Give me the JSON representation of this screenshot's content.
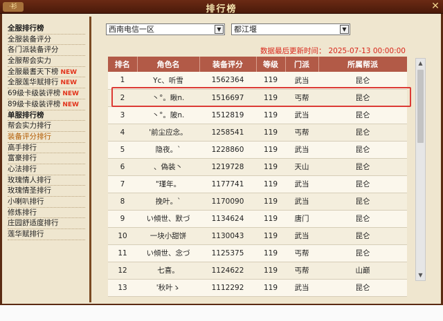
{
  "window": {
    "title": "排行榜",
    "logo_text": "·衫",
    "close_glyph": "✕"
  },
  "sidebar": {
    "items": [
      {
        "label": "全服排行榜",
        "type": "header",
        "new": ""
      },
      {
        "label": "全服装备评分",
        "type": "item",
        "new": ""
      },
      {
        "label": "各门派装备评分",
        "type": "item",
        "new": ""
      },
      {
        "label": "全服帮会实力",
        "type": "item",
        "new": ""
      },
      {
        "label": "全服最耆天下榜",
        "type": "item",
        "new": "NEW"
      },
      {
        "label": "全服莲华赋排行",
        "type": "item",
        "new": "NEW"
      },
      {
        "label": "69级卡级装评榜",
        "type": "item",
        "new": "NEW"
      },
      {
        "label": "89级卡级装评榜",
        "type": "item",
        "new": "NEW"
      },
      {
        "label": "单服排行榜",
        "type": "header",
        "new": ""
      },
      {
        "label": "帮会实力排行",
        "type": "item",
        "new": ""
      },
      {
        "label": "装备评分排行",
        "type": "active",
        "new": ""
      },
      {
        "label": "高手排行",
        "type": "item",
        "new": ""
      },
      {
        "label": "富豪排行",
        "type": "item",
        "new": ""
      },
      {
        "label": "心法排行",
        "type": "item",
        "new": ""
      },
      {
        "label": "玫瑰情人排行",
        "type": "item",
        "new": ""
      },
      {
        "label": "玫瑰情圣排行",
        "type": "item",
        "new": ""
      },
      {
        "label": "小喇叭排行",
        "type": "item",
        "new": ""
      },
      {
        "label": "修炼排行",
        "type": "item",
        "new": ""
      },
      {
        "label": "庄园舒适度排行",
        "type": "item",
        "new": ""
      },
      {
        "label": "莲华赋排行",
        "type": "item",
        "new": ""
      }
    ]
  },
  "filters": {
    "region": {
      "value": "西南电信一区"
    },
    "server": {
      "value": "都江堰"
    },
    "arrow_glyph": "▼"
  },
  "update": {
    "label": "数据最后更新时间：",
    "time": "2025-07-13 00:00:00"
  },
  "table": {
    "headers": [
      "排名",
      "角色名",
      "装备评分",
      "等级",
      "门派",
      "所属帮派"
    ],
    "rows": [
      [
        "1",
        "Yc、听雪",
        "1562364",
        "119",
        "武当",
        "昆仑"
      ],
      [
        "2",
        "丶°。瞅n.",
        "1516697",
        "119",
        "丐帮",
        "昆仑"
      ],
      [
        "3",
        "丶°。陂n.",
        "1512819",
        "119",
        "武当",
        "昆仑"
      ],
      [
        "4",
        "'前尘应念。",
        "1258541",
        "119",
        "丐帮",
        "昆仑"
      ],
      [
        "5",
        "隐夜。`",
        "1228860",
        "119",
        "武当",
        "昆仑"
      ],
      [
        "6",
        "、偽装丶",
        "1219728",
        "119",
        "天山",
        "昆仑"
      ],
      [
        "7",
        "\"瑾年。",
        "1177741",
        "119",
        "武当",
        "昆仑"
      ],
      [
        "8",
        "挽叶。`",
        "1170090",
        "119",
        "武当",
        "昆仑"
      ],
      [
        "9",
        "い傾世、默づ",
        "1134624",
        "119",
        "唐门",
        "昆仑"
      ],
      [
        "10",
        "一块小甜饼",
        "1130043",
        "119",
        "武当",
        "昆仑"
      ],
      [
        "11",
        "い傾世、念づ",
        "1125375",
        "119",
        "丐帮",
        "昆仑"
      ],
      [
        "12",
        "七喜。",
        "1124622",
        "119",
        "丐帮",
        "山巅"
      ],
      [
        "13",
        "'秋叶ゝ",
        "1112292",
        "119",
        "武当",
        "昆仑"
      ]
    ]
  },
  "scrollbar": {
    "up_glyph": "▲",
    "down_glyph": "▼"
  }
}
